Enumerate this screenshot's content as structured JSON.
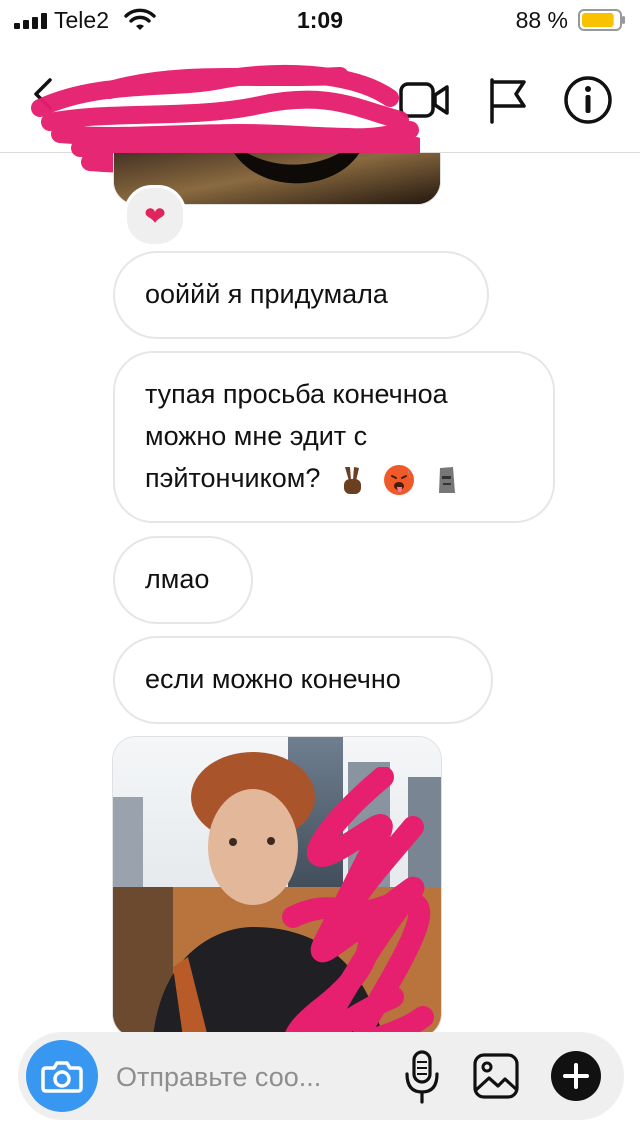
{
  "status_bar": {
    "carrier": "Tele2",
    "time": "1:09",
    "battery_percent": "88 %",
    "battery_level": 0.88
  },
  "header": {
    "title": "",
    "icons": [
      "back-arrow-icon",
      "video-camera-icon",
      "flag-icon",
      "info-icon"
    ],
    "scribble_color": "#e6206f"
  },
  "chat": {
    "reaction": "❤",
    "messages": [
      {
        "text": "ооййй я придумала"
      },
      {
        "text": "тупая просьба конечноа можно мне эдит с пэйтончиком?",
        "emojis": [
          "victory-hand-icon",
          "hot-face-icon",
          "moai-icon"
        ]
      },
      {
        "text": "лмао"
      },
      {
        "text": "если можно конечно"
      }
    ]
  },
  "composer": {
    "placeholder": "Отправьте соо...",
    "accent": "#3897f0"
  }
}
